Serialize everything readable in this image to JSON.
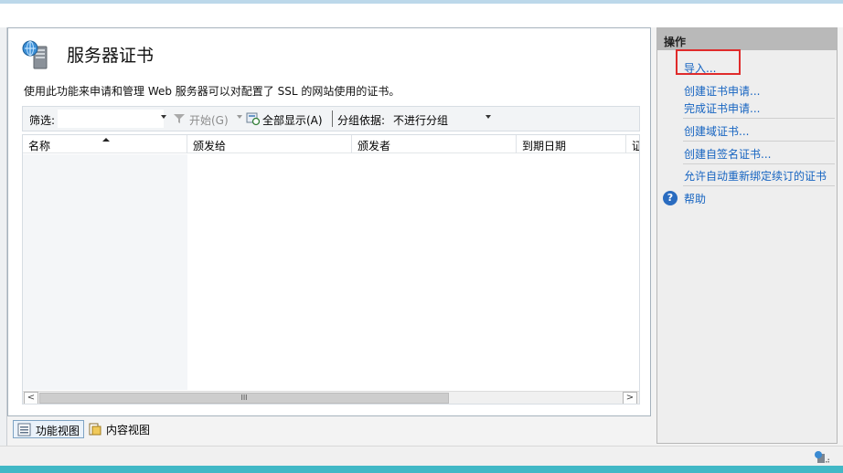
{
  "page": {
    "title": "服务器证书",
    "description": "使用此功能来申请和管理 Web 服务器可以对配置了 SSL 的网站使用的证书。"
  },
  "toolbar": {
    "filter_label": "筛选:",
    "filter_value": "",
    "go_label": "开始(G)",
    "show_all_label": "全部显示(A)",
    "group_by_label": "分组依据:",
    "group_by_value": "不进行分组"
  },
  "list": {
    "columns": [
      "名称",
      "颁发给",
      "颁发者",
      "到期日期",
      "证"
    ],
    "rows": [],
    "scroll_grip": "III"
  },
  "view_tabs": [
    "功能视图",
    "内容视图"
  ],
  "actions": {
    "header": "操作",
    "items": [
      "导入...",
      "创建证书申请...",
      "完成证书申请...",
      "创建域证书...",
      "创建自签名证书...",
      "允许自动重新绑定续订的证书",
      "帮助"
    ],
    "highlight_color": "#e02b2b",
    "link_color": "#1664c1"
  },
  "icons": {
    "page": "server-certificate-icon",
    "filter": "funnel-icon",
    "show_all": "show-all-icon",
    "features_view": "features-view-icon",
    "content_view": "content-view-icon",
    "help": "help-icon",
    "status": "network-status-icon"
  }
}
